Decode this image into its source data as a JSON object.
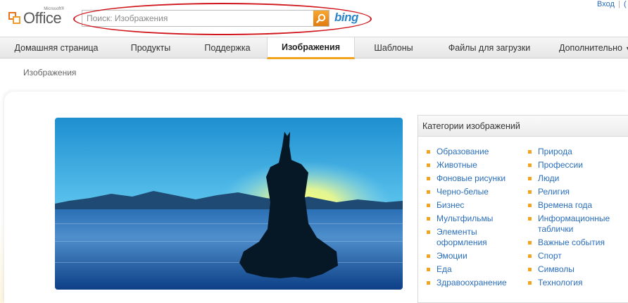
{
  "header": {
    "logo_text": "Office",
    "logo_superscript": "Microsoft®",
    "search_placeholder": "Поиск: Изображения",
    "search_brand": "bing",
    "signin_label": "Вход",
    "signin_extra": "("
  },
  "nav": {
    "items": [
      {
        "label": "Домашняя страница"
      },
      {
        "label": "Продукты"
      },
      {
        "label": "Поддержка"
      },
      {
        "label": "Изображения"
      },
      {
        "label": "Шаблоны"
      },
      {
        "label": "Файлы для загрузки"
      },
      {
        "label": "Дополнительно"
      }
    ],
    "active_index": 3
  },
  "breadcrumb": "Изображения",
  "categories": {
    "title": "Категории изображений",
    "left": [
      "Образование",
      "Животные",
      "Фоновые рисунки",
      "Черно-белые",
      "Бизнес",
      "Мультфильмы",
      "Элементы оформления",
      "Эмоции",
      "Еда",
      "Здравоохранение"
    ],
    "right": [
      "Природа",
      "Профессии",
      "Люди",
      "Религия",
      "Времена года",
      "Информационные таблички",
      "Важные события",
      "Спорт",
      "Символы",
      "Технология"
    ]
  },
  "colors": {
    "accent": "#f2a41f",
    "link": "#2a6ebb",
    "annotation": "#d0161c",
    "bing": "#2a86c8"
  }
}
